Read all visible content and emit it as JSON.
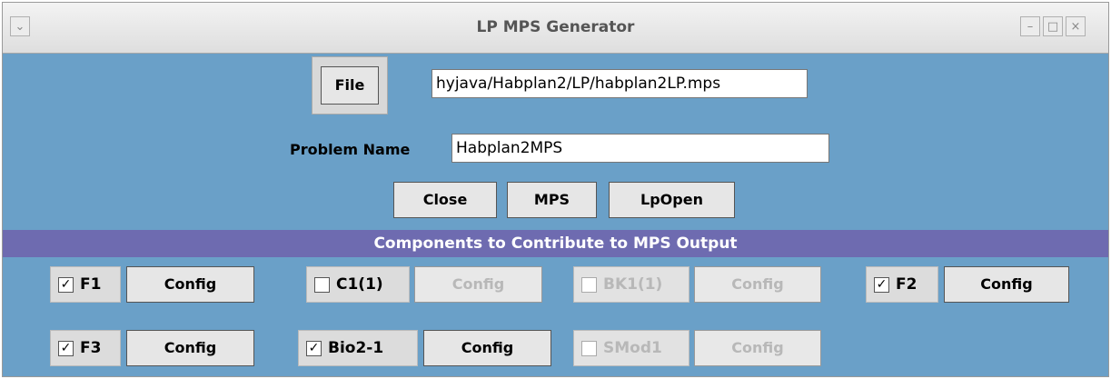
{
  "window": {
    "title": "LP MPS Generator",
    "menu_icon": "chevron-down-icon",
    "controls": [
      "minimize-icon",
      "maximize-icon",
      "close-icon"
    ]
  },
  "file": {
    "button_label": "File",
    "path_value": "hyjava/Habplan2/LP/habplan2LP.mps"
  },
  "problem": {
    "label": "Problem Name",
    "value": "Habplan2MPS"
  },
  "actions": {
    "close_label": "Close",
    "mps_label": "MPS",
    "lpopen_label": "LpOpen"
  },
  "components": {
    "title": "Components to Contribute to MPS Output",
    "config_label": "Config",
    "items": [
      {
        "label": "F1",
        "checked": true,
        "enabled": true
      },
      {
        "label": "C1(1)",
        "checked": false,
        "enabled": true
      },
      {
        "label": "BK1(1)",
        "checked": false,
        "enabled": false
      },
      {
        "label": "F2",
        "checked": true,
        "enabled": true
      },
      {
        "label": "F3",
        "checked": true,
        "enabled": true
      },
      {
        "label": "Bio2-1",
        "checked": true,
        "enabled": true
      },
      {
        "label": "SMod1",
        "checked": false,
        "enabled": false
      }
    ]
  }
}
